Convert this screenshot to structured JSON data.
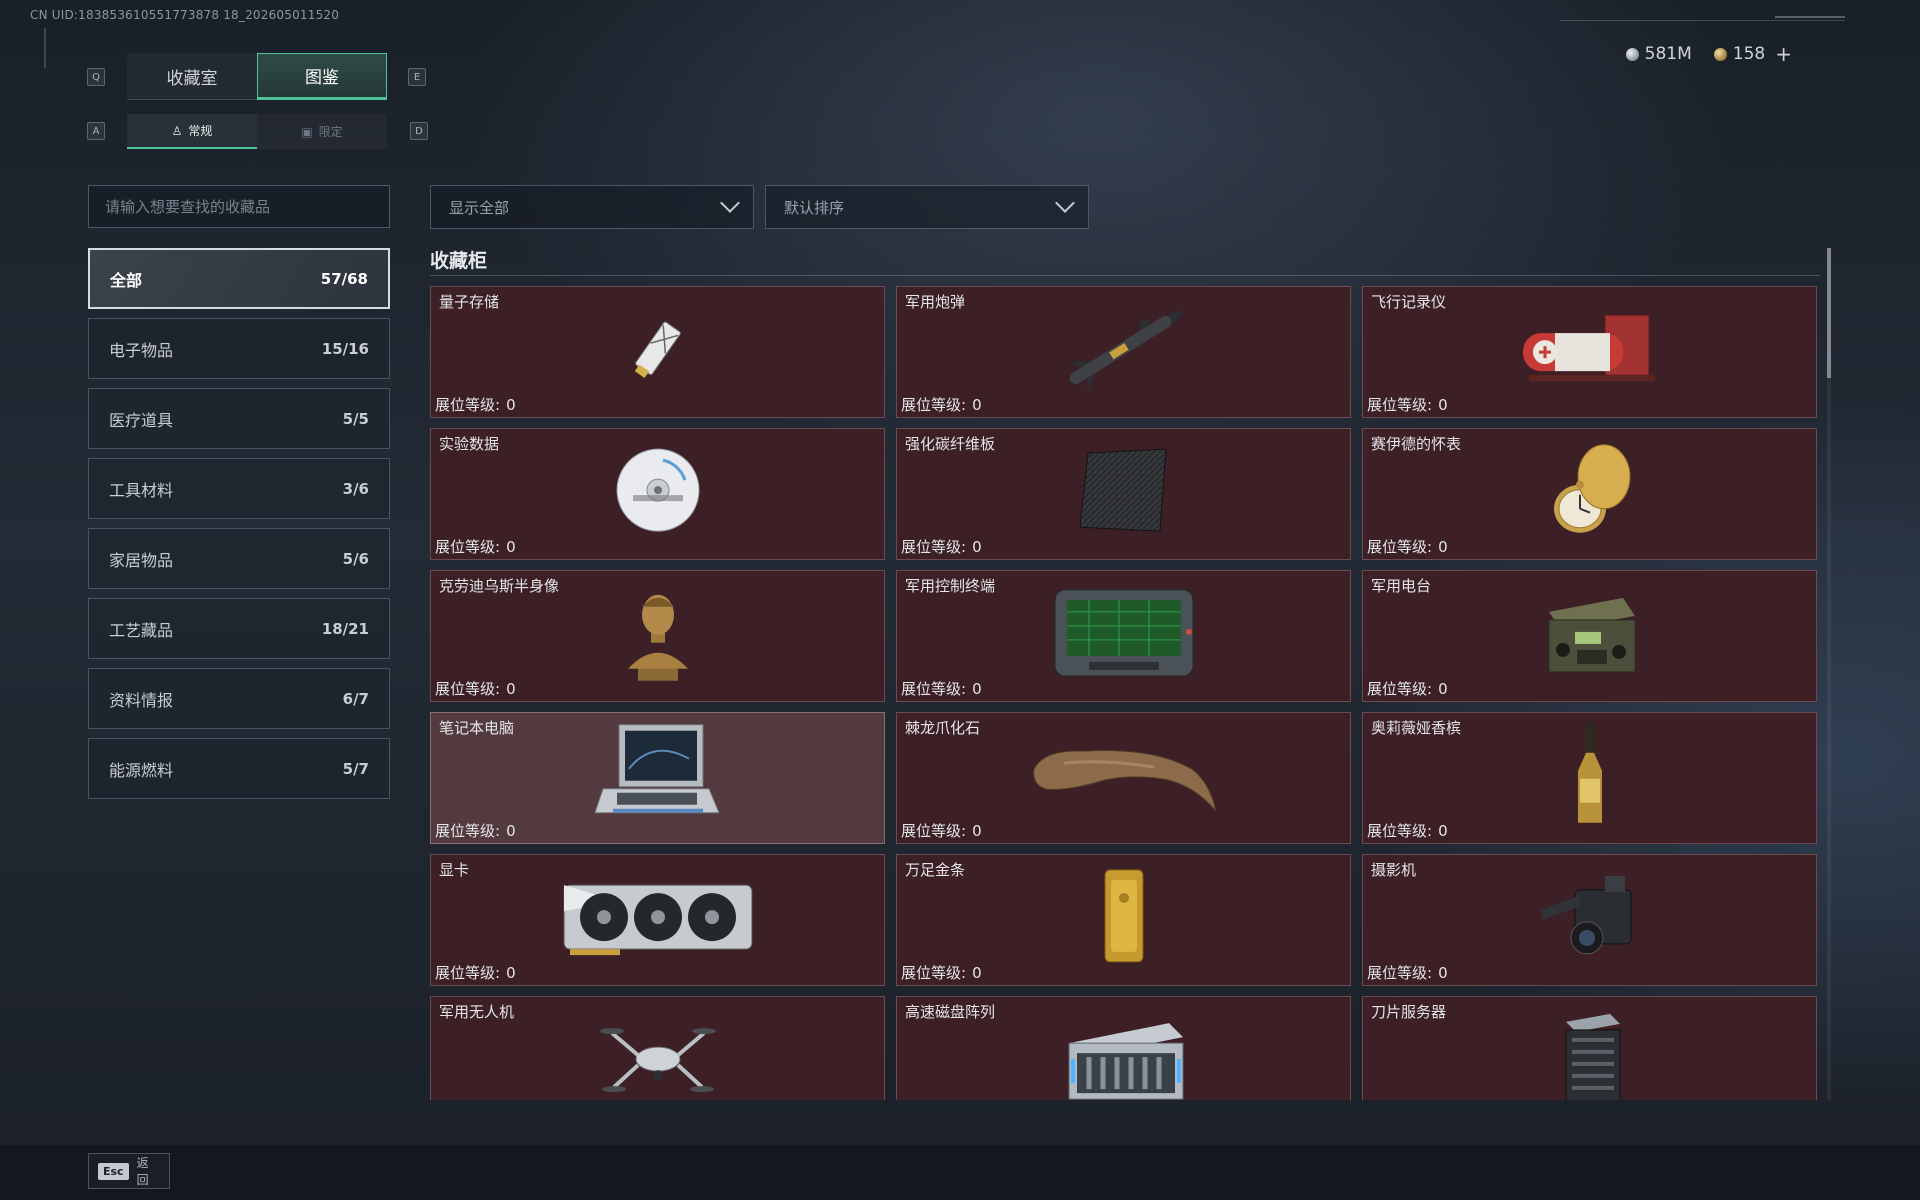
{
  "uid": "CN UID:183853610551773878 18_202605011520",
  "currency": {
    "silver": "581M",
    "gold": "158",
    "plus": "+"
  },
  "keys": {
    "prev_tab": "Q",
    "next_tab": "E",
    "prev_sub": "A",
    "next_sub": "D"
  },
  "tabs": [
    {
      "label": "收藏室",
      "active": false
    },
    {
      "label": "图鉴",
      "active": true
    }
  ],
  "sub_tabs": [
    {
      "label": "常规",
      "icon": "figure-icon",
      "active": true
    },
    {
      "label": "限定",
      "icon": "image-icon",
      "active": false
    }
  ],
  "search": {
    "placeholder": "请输入想要查找的收藏品",
    "value": ""
  },
  "filters": {
    "display": "显示全部",
    "sort": "默认排序"
  },
  "categories": [
    {
      "name": "全部",
      "count": "57/68",
      "active": true
    },
    {
      "name": "电子物品",
      "count": "15/16"
    },
    {
      "name": "医疗道具",
      "count": "5/5"
    },
    {
      "name": "工具材料",
      "count": "3/6"
    },
    {
      "name": "家居物品",
      "count": "5/6"
    },
    {
      "name": "工艺藏品",
      "count": "18/21"
    },
    {
      "name": "资料情报",
      "count": "6/7"
    },
    {
      "name": "能源燃料",
      "count": "5/7"
    }
  ],
  "section_title": "收藏柜",
  "level_label": "展位等级:",
  "items": [
    {
      "name": "量子存储",
      "level": "0",
      "icon": "quantum-storage-icon"
    },
    {
      "name": "军用炮弹",
      "level": "0",
      "icon": "missile-icon"
    },
    {
      "name": "飞行记录仪",
      "level": "0",
      "icon": "flight-recorder-icon"
    },
    {
      "name": "实验数据",
      "level": "0",
      "icon": "disc-icon"
    },
    {
      "name": "强化碳纤维板",
      "level": "0",
      "icon": "carbon-plate-icon"
    },
    {
      "name": "赛伊德的怀表",
      "level": "0",
      "icon": "pocket-watch-icon"
    },
    {
      "name": "克劳迪乌斯半身像",
      "level": "0",
      "icon": "bust-icon"
    },
    {
      "name": "军用控制终端",
      "level": "0",
      "icon": "control-terminal-icon"
    },
    {
      "name": "军用电台",
      "level": "0",
      "icon": "radio-icon"
    },
    {
      "name": "笔记本电脑",
      "level": "0",
      "icon": "laptop-icon",
      "highlighted": true
    },
    {
      "name": "棘龙爪化石",
      "level": "0",
      "icon": "claw-fossil-icon"
    },
    {
      "name": "奥莉薇娅香槟",
      "level": "0",
      "icon": "champagne-icon"
    },
    {
      "name": "显卡",
      "level": "0",
      "icon": "graphics-card-icon"
    },
    {
      "name": "万足金条",
      "level": "0",
      "icon": "gold-bar-icon"
    },
    {
      "name": "摄影机",
      "level": "0",
      "icon": "camera-icon"
    },
    {
      "name": "军用无人机",
      "level": "",
      "icon": "drone-icon"
    },
    {
      "name": "高速磁盘阵列",
      "level": "",
      "icon": "disk-array-icon"
    },
    {
      "name": "刀片服务器",
      "level": "",
      "icon": "blade-server-icon"
    }
  ],
  "footer": {
    "esc_key": "Esc",
    "back_label": "返回"
  }
}
